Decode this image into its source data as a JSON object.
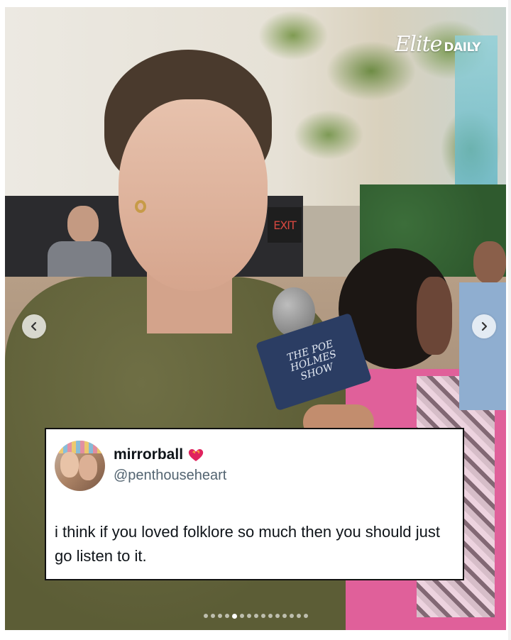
{
  "brand": {
    "logo_script": "Elite",
    "logo_block": "DAILY"
  },
  "scene": {
    "exit_sign": "EXIT",
    "mic_flag_lines": [
      "THE POE",
      "HOLMES",
      "SHOW"
    ]
  },
  "tweet": {
    "display_name": "mirrorball",
    "badge_icon": "burning-heart-icon",
    "handle": "@penthouseheart",
    "text": "i think if you loved folklore so much then you should just go listen to it."
  },
  "carousel": {
    "prev_icon": "chevron-left-icon",
    "next_icon": "chevron-right-icon",
    "total_slides": 15,
    "active_index": 4
  },
  "colors": {
    "heart": "#e0245e",
    "border": "#111111"
  }
}
